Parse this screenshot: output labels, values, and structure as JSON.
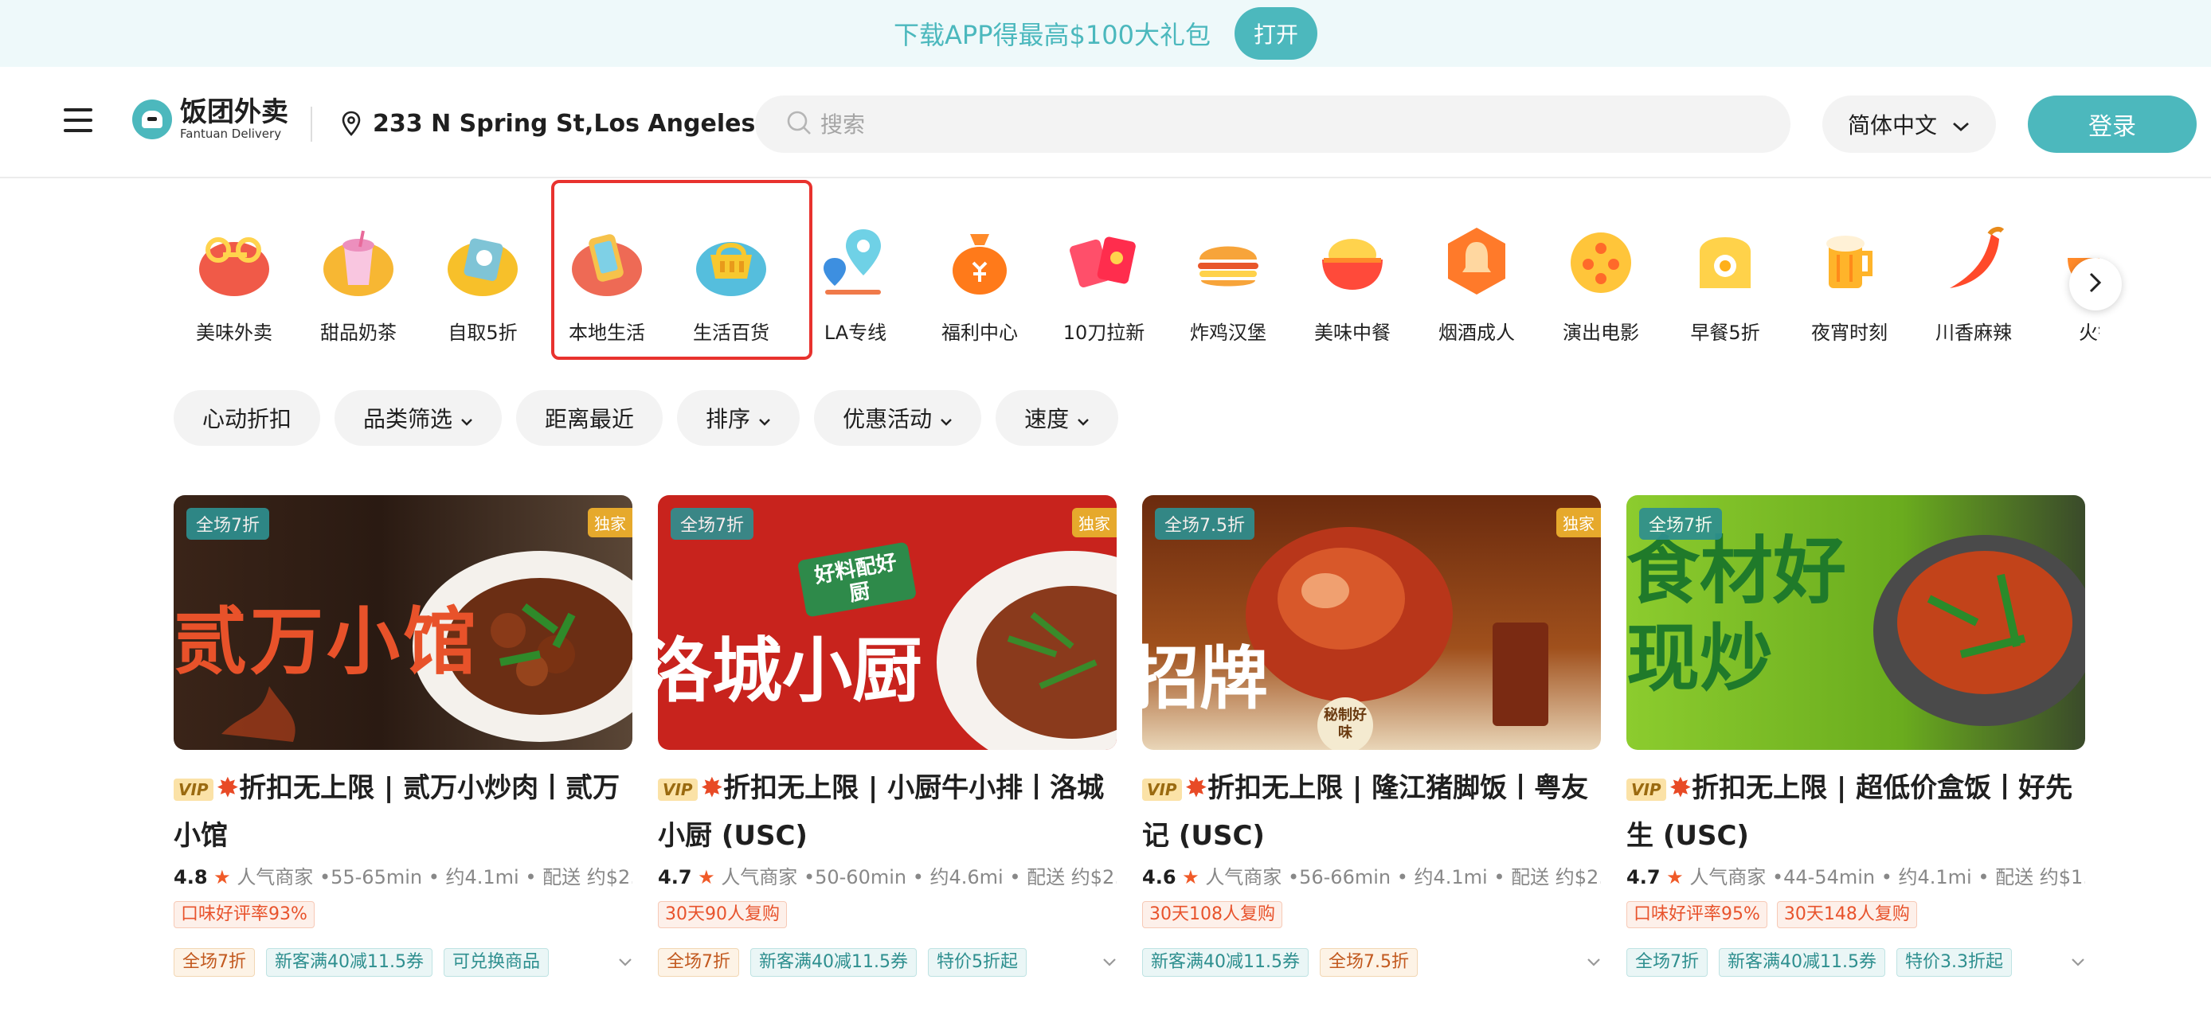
{
  "promo": {
    "text": "下载APP得最高$100大礼包",
    "button": "打开"
  },
  "header": {
    "logo_cn": "饭团外卖",
    "logo_en": "Fantuan Delivery",
    "location": "233 N Spring St,Los Angeles",
    "search_placeholder": "搜索",
    "language": "简体中文",
    "login": "登录"
  },
  "categories": [
    {
      "label": "美味外卖",
      "icon": "scooter-icon"
    },
    {
      "label": "甜品奶茶",
      "icon": "milk-tea-icon"
    },
    {
      "label": "自取5折",
      "icon": "pickup-bag-icon"
    },
    {
      "label": "本地生活",
      "icon": "phone-icon"
    },
    {
      "label": "生活百货",
      "icon": "basket-icon"
    },
    {
      "label": "LA专线",
      "icon": "map-pin-icon"
    },
    {
      "label": "福利中心",
      "icon": "money-bag-icon"
    },
    {
      "label": "10刀拉新",
      "icon": "red-envelope-icon"
    },
    {
      "label": "炸鸡汉堡",
      "icon": "burger-icon"
    },
    {
      "label": "美味中餐",
      "icon": "rice-bowl-icon"
    },
    {
      "label": "烟酒成人",
      "icon": "bell-icon"
    },
    {
      "label": "演出电影",
      "icon": "film-reel-icon"
    },
    {
      "label": "早餐5折",
      "icon": "toast-icon"
    },
    {
      "label": "夜宵时刻",
      "icon": "beer-icon"
    },
    {
      "label": "川香麻辣",
      "icon": "chili-icon"
    },
    {
      "label": "火锅",
      "icon": "hotpot-icon"
    }
  ],
  "filters": [
    {
      "label": "心动折扣",
      "dropdown": false
    },
    {
      "label": "品类筛选",
      "dropdown": true
    },
    {
      "label": "距离最近",
      "dropdown": false
    },
    {
      "label": "排序",
      "dropdown": true
    },
    {
      "label": "优惠活动",
      "dropdown": true
    },
    {
      "label": "速度",
      "dropdown": true
    }
  ],
  "cards": [
    {
      "discount_badge": "全场7折",
      "exclusive": "独家",
      "vip": "VIP",
      "title": "折扣无上限 | 贰万小炒肉丨贰万小馆",
      "rating": "4.8",
      "meta": "人气商家 •55-65min • 约4.1mi • 配送 约$2.…",
      "red_tags": [
        "口味好评率93%"
      ],
      "promo_tags": [
        {
          "text": "全场7折",
          "kind": "orange"
        },
        {
          "text": "新客满40减11.5券",
          "kind": "teal"
        },
        {
          "text": "可兑换商品",
          "kind": "teal"
        }
      ],
      "image_text": "贰万小馆",
      "image_bg": "#2a1a12"
    },
    {
      "discount_badge": "全场7折",
      "exclusive": "独家",
      "vip": "VIP",
      "title": "折扣无上限 | 小厨牛小排丨洛城小厨 (USC)",
      "rating": "4.7",
      "meta": "人气商家 •50-60min • 约4.6mi • 配送 约$2.…",
      "red_tags": [
        "30天90人复购"
      ],
      "promo_tags": [
        {
          "text": "全场7折",
          "kind": "orange"
        },
        {
          "text": "新客满40减11.5券",
          "kind": "teal"
        },
        {
          "text": "特价5折起",
          "kind": "teal"
        }
      ],
      "image_text": "洛城小厨",
      "image_sub": "好料配好厨",
      "image_bg": "#c8231d"
    },
    {
      "discount_badge": "全场7.5折",
      "exclusive": "独家",
      "vip": "VIP",
      "title": "折扣无上限 | 隆江猪脚饭丨粤友记 (USC)",
      "rating": "4.6",
      "meta": "人气商家 •56-66min • 约4.1mi • 配送 约$2.…",
      "red_tags": [
        "30天108人复购"
      ],
      "promo_tags": [
        {
          "text": "新客满40减11.5券",
          "kind": "teal"
        },
        {
          "text": "全场7.5折",
          "kind": "orange"
        }
      ],
      "image_text": "招牌",
      "image_sub": "秘制好味",
      "image_bg": "#8a3a12"
    },
    {
      "discount_badge": "全场7折",
      "exclusive": "",
      "vip": "VIP",
      "title": "折扣无上限 | 超低价盒饭丨好先生 (USC)",
      "rating": "4.7",
      "meta": "人气商家 •44-54min • 约4.1mi • 配送 约$1.…",
      "red_tags": [
        "口味好评率95%",
        "30天148人复购"
      ],
      "promo_tags": [
        {
          "text": "全场7折",
          "kind": "teal"
        },
        {
          "text": "新客满40减11.5券",
          "kind": "teal"
        },
        {
          "text": "特价3.3折起",
          "kind": "teal"
        }
      ],
      "image_text": "食材好 现炒",
      "image_bg": "#7cc22a"
    }
  ],
  "colors": {
    "brand": "#4cb8bd",
    "highlight": "#e8322e"
  }
}
